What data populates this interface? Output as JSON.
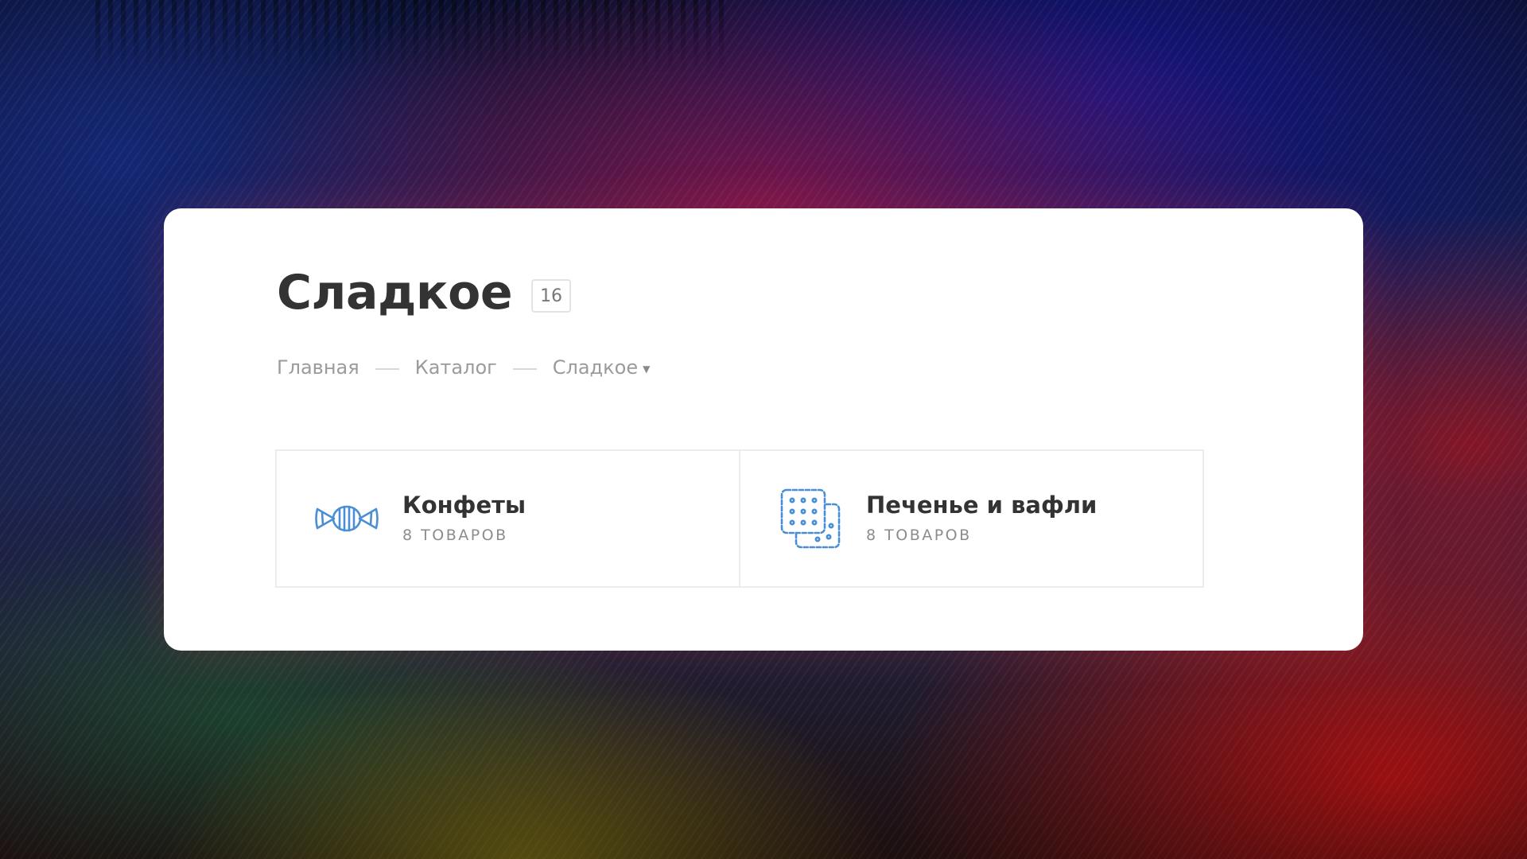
{
  "page": {
    "title": "Сладкое",
    "count_badge": "16"
  },
  "breadcrumb": {
    "items": [
      {
        "label": "Главная"
      },
      {
        "label": "Каталог"
      },
      {
        "label": "Сладкое"
      }
    ]
  },
  "categories": [
    {
      "name": "Конфеты",
      "count": "8 ТОВАРОВ",
      "icon": "candy-icon"
    },
    {
      "name": "Печенье и вафли",
      "count": "8 ТОВАРОВ",
      "icon": "cookies-icon"
    }
  ],
  "colors": {
    "accent": "#4a8fd4",
    "title": "#333333",
    "muted": "#9b9b9b"
  }
}
